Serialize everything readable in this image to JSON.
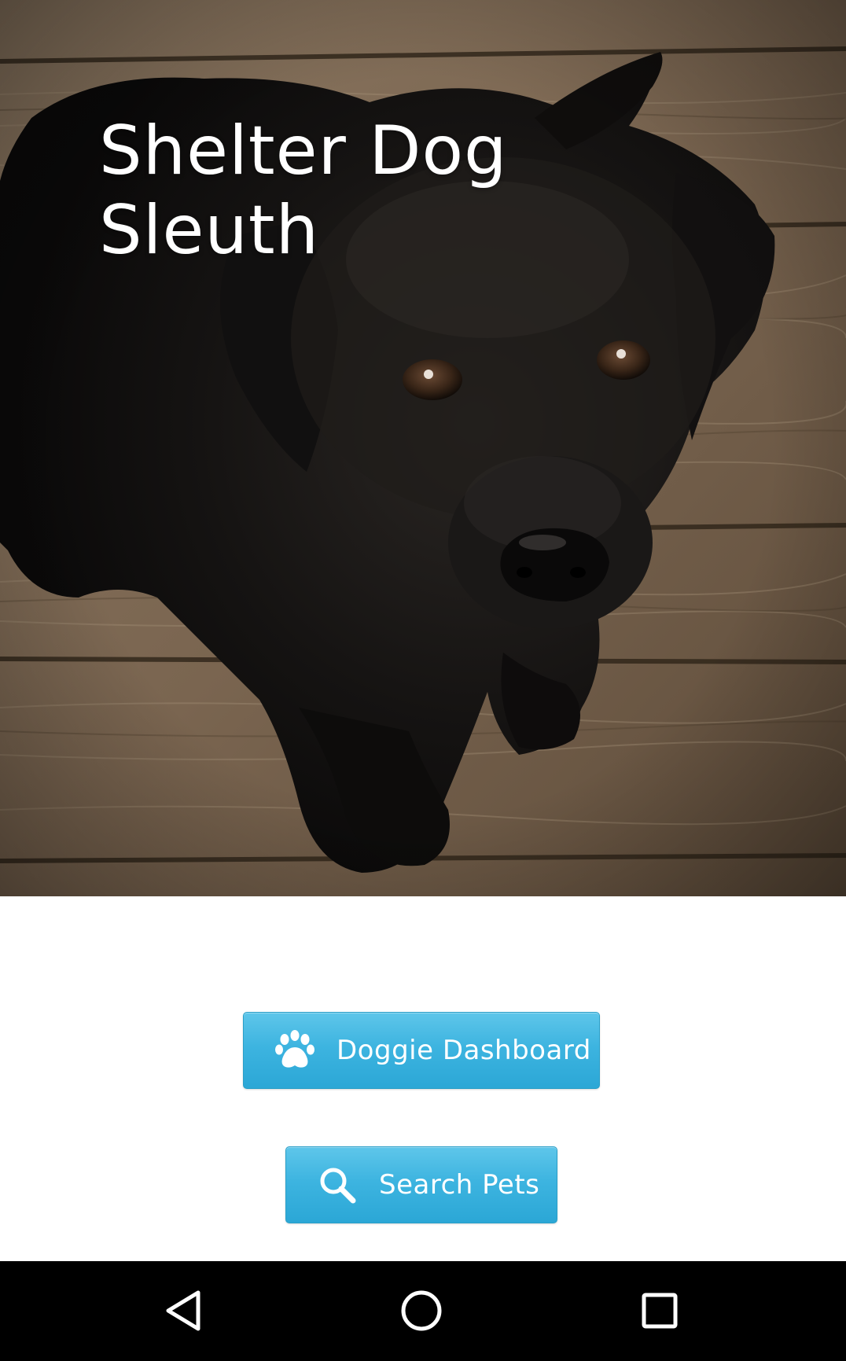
{
  "app": {
    "title_line1": "Shelter Dog",
    "title_line2": "Sleuth"
  },
  "hero": {
    "image_subject": "black-labrador-puppy-on-wooden-floor"
  },
  "buttons": {
    "dashboard": {
      "label": "Doggie Dashboard",
      "icon": "paw-icon"
    },
    "search": {
      "label": "Search Pets",
      "icon": "search-icon"
    }
  },
  "nav": {
    "back_icon": "back-triangle-icon",
    "home_icon": "home-circle-icon",
    "recent_icon": "recent-apps-square-icon"
  },
  "colors": {
    "button_top": "#5ec6ea",
    "button_bottom": "#2ba7d6",
    "button_border": "#2a9fc8",
    "navbar": "#000000",
    "title": "#ffffff"
  }
}
